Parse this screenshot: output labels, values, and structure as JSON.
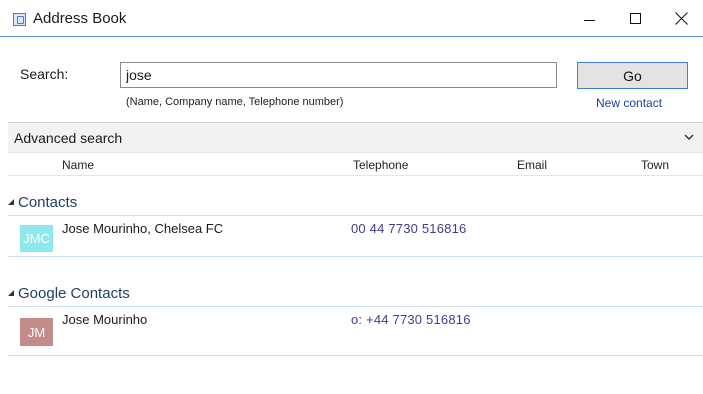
{
  "window": {
    "title": "Address Book",
    "icon": "address-book-icon"
  },
  "search": {
    "label": "Search:",
    "value": "jose",
    "hint": "(Name, Company name, Telephone number)",
    "go_label": "Go",
    "new_contact_label": "New contact"
  },
  "advanced": {
    "label": "Advanced search"
  },
  "columns": {
    "name": "Name",
    "telephone": "Telephone",
    "email": "Email",
    "town": "Town"
  },
  "groups": [
    {
      "title": "Contacts",
      "rows": [
        {
          "initials": "JMC",
          "avatar_color": "#8ee8ec",
          "name": "Jose Mourinho, Chelsea FC",
          "telephone": "00 44 7730 516816",
          "email": "",
          "town": ""
        }
      ]
    },
    {
      "title": "Google Contacts",
      "rows": [
        {
          "initials": "JM",
          "avatar_color": "#c48c88",
          "name": "Jose Mourinho",
          "telephone": "o: +44 7730 516816",
          "email": "",
          "town": ""
        }
      ]
    }
  ],
  "colors": {
    "accent": "#3f7fd1",
    "link": "#1a3ea8",
    "telephone": "#3d3f8e",
    "group_title": "#1f3f66"
  }
}
